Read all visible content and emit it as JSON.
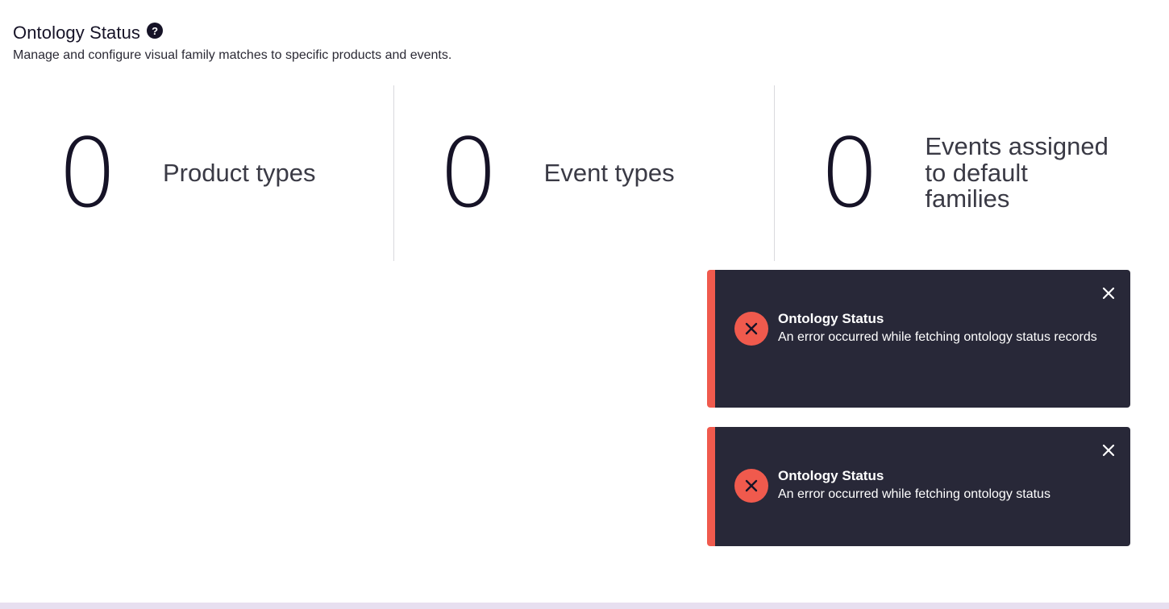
{
  "header": {
    "title": "Ontology Status",
    "help_glyph": "?",
    "subtitle": "Manage and configure visual family matches to specific products and events."
  },
  "stats": [
    {
      "value": "0",
      "label": "Product types"
    },
    {
      "value": "0",
      "label": "Event types"
    },
    {
      "value": "0",
      "label": "Events assigned to default families"
    }
  ],
  "toasts": [
    {
      "title": "Ontology Status",
      "message": "An error occurred while fetching ontology status records",
      "icon": "error-x-icon",
      "close_icon": "close-icon"
    },
    {
      "title": "Ontology Status",
      "message": "An error occurred while fetching ontology status",
      "icon": "error-x-icon",
      "close_icon": "close-icon"
    }
  ],
  "colors": {
    "text_primary": "#161327",
    "toast_background": "#282838",
    "error_accent": "#f05a4d",
    "divider": "#d9d9de",
    "bottom_bar": "#e7dff0"
  }
}
